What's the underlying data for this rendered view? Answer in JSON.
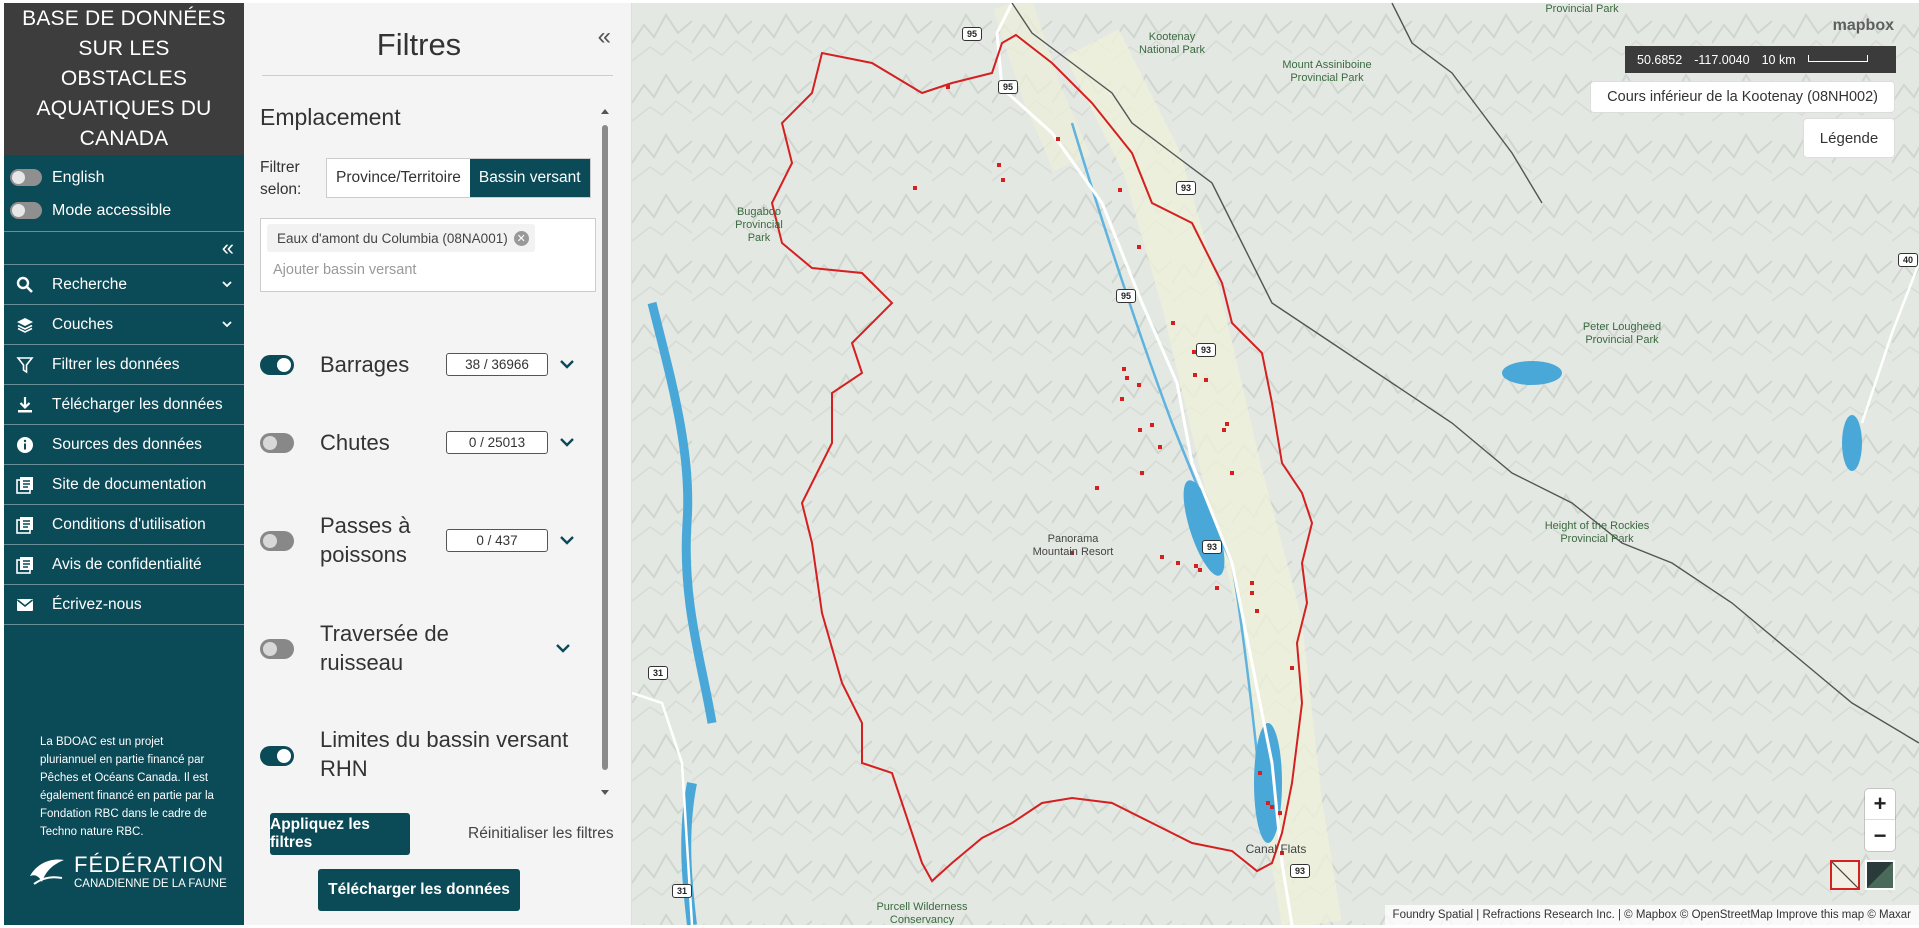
{
  "sidebar": {
    "title": "BASE DE DONNÉES SUR LES OBSTACLES AQUATIQUES DU CANADA",
    "toggles": [
      {
        "label": "English"
      },
      {
        "label": "Mode accessible"
      }
    ],
    "collapse_glyph": "«",
    "nav": [
      {
        "label": "Recherche",
        "icon": "search-icon",
        "expandable": true
      },
      {
        "label": "Couches",
        "icon": "layers-icon",
        "expandable": true
      },
      {
        "label": "Filtrer les données",
        "icon": "filter-icon"
      },
      {
        "label": "Télécharger les données",
        "icon": "download-icon"
      },
      {
        "label": "Sources des données",
        "icon": "info-icon"
      },
      {
        "label": "Site de documentation",
        "icon": "document-icon"
      },
      {
        "label": "Conditions d'utilisation",
        "icon": "document-icon"
      },
      {
        "label": "Avis de confidentialité",
        "icon": "document-icon"
      },
      {
        "label": "Écrivez-nous",
        "icon": "mail-icon"
      }
    ],
    "funding_text": "La BDOAC est un projet pluriannuel en partie financé par Pêches et Océans Canada. Il est également financé en partie par la Fondation RBC dans le cadre de Techno nature RBC.",
    "fcf_name": "FÉDÉRATION",
    "fcf_sub": "CANADIENNE DE LA FAUNE"
  },
  "filters": {
    "title": "Filtres",
    "collapse_glyph": "«",
    "section": "Emplacement",
    "filter_by": "Filtrer selon:",
    "segments": [
      {
        "label": "Province/Territoire",
        "active": false
      },
      {
        "label": "Bassin versant",
        "active": true
      }
    ],
    "chip": "Eaux d'amont du Columbia (08NA001)",
    "chip_placeholder": "Ajouter bassin versant",
    "layers": [
      {
        "label": "Barrages",
        "on": true,
        "count": "38 / 36966"
      },
      {
        "label": "Chutes",
        "on": false,
        "count": "0 / 25013"
      },
      {
        "label": "Passes à poissons",
        "on": false,
        "count": "0 / 437"
      },
      {
        "label": "Traversée de ruisseau",
        "on": false
      },
      {
        "label": "Limites du bassin versant RHN",
        "on": true
      }
    ],
    "apply": "Appliquez les filtres",
    "reset": "Réinitialiser les filtres",
    "download": "Télécharger les données"
  },
  "map": {
    "lat": "50.6852",
    "lon": "-117.0040",
    "scale": "10 km",
    "logo": "mapbox",
    "basin_label": "Cours inférieur de la Kootenay (08NH002)",
    "legend": "Légende",
    "zoom_in": "+",
    "zoom_out": "−",
    "attribution": "Foundry Spatial | Refractions Research Inc. | © Mapbox © OpenStreetMap Improve this map © Maxar",
    "places": [
      {
        "name": "Kootenay National Park"
      },
      {
        "name": "Mount Assiniboine Provincial Park"
      },
      {
        "name": "Bugaboo Provincial Park"
      },
      {
        "name": "Peter Lougheed Provincial Park"
      },
      {
        "name": "Height of the Rockies Provincial Park"
      },
      {
        "name": "Panorama Mountain Resort"
      },
      {
        "name": "Canal Flats"
      },
      {
        "name": "Purcell Wilderness Conservancy"
      },
      {
        "name": "Provincial Park"
      }
    ],
    "highways": [
      "95",
      "95",
      "93",
      "95",
      "93",
      "93",
      "31",
      "31",
      "93",
      "40"
    ],
    "colors": {
      "boundary": "#d42020",
      "dam": "#d42020",
      "water": "#4aa8d8",
      "terrain": "#e3e8e3"
    }
  }
}
